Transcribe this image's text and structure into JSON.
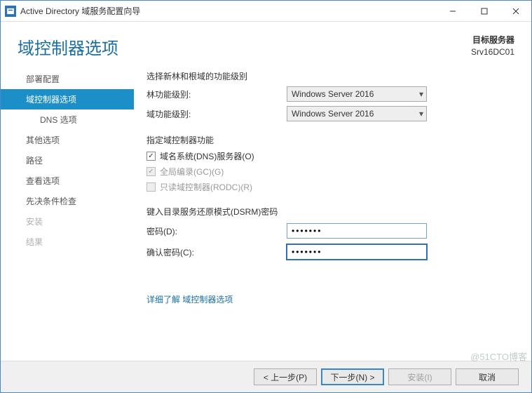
{
  "window": {
    "title": "Active Directory 域服务配置向导"
  },
  "header": {
    "heading": "域控制器选项",
    "target_label": "目标服务器",
    "target_value": "Srv16DC01"
  },
  "sidebar": {
    "items": [
      {
        "label": "部署配置",
        "active": false
      },
      {
        "label": "域控制器选项",
        "active": true
      },
      {
        "label": "DNS 选项",
        "sub": true
      },
      {
        "label": "其他选项"
      },
      {
        "label": "路径"
      },
      {
        "label": "查看选项"
      },
      {
        "label": "先决条件检查"
      },
      {
        "label": "安装",
        "disabled": true
      },
      {
        "label": "结果",
        "disabled": true
      }
    ]
  },
  "main": {
    "func_level_title": "选择新林和根域的功能级别",
    "forest_level_label": "林功能级别:",
    "forest_level_value": "Windows Server 2016",
    "domain_level_label": "域功能级别:",
    "domain_level_value": "Windows Server 2016",
    "dc_caps_title": "指定域控制器功能",
    "cb_dns": "域名系统(DNS)服务器(O)",
    "cb_gc": "全局编录(GC)(G)",
    "cb_rodc": "只读域控制器(RODC)(R)",
    "dsrm_title": "键入目录服务还原模式(DSRM)密码",
    "pw_label": "密码(D):",
    "pw_value": "•••••••",
    "pw_confirm_label": "确认密码(C):",
    "pw_confirm_value": "•••••••",
    "link": "详细了解 域控制器选项"
  },
  "footer": {
    "prev": "< 上一步(P)",
    "next": "下一步(N) >",
    "install": "安装(I)",
    "cancel": "取消"
  },
  "watermark": "@51CTO博客"
}
